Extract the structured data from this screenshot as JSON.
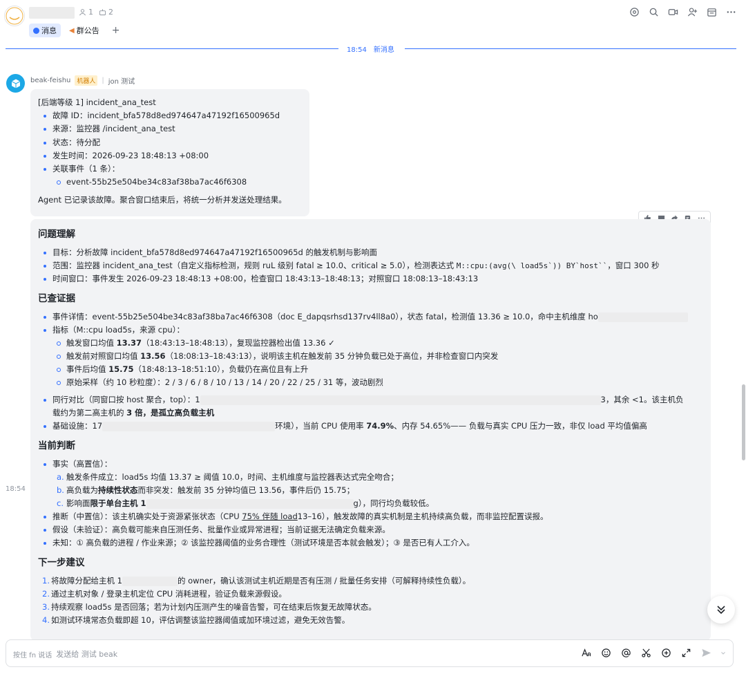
{
  "header": {
    "members_count": "1",
    "bots_count": "2",
    "tabs": [
      {
        "label": "消息"
      },
      {
        "label": "群公告"
      }
    ],
    "add_tab": "+"
  },
  "divider": {
    "time": "18:54",
    "label": "新消息"
  },
  "message": {
    "sender": "beak-feishu",
    "bot_tag": "机器人",
    "separator": "|",
    "reply_to": "jon 测试",
    "side_time": "18:54"
  },
  "card1": {
    "title": "[后端等级 1] incident_ana_test",
    "items": [
      "故障 ID：incident_bfa578d8ed974647a47192f16500965d",
      "来源：监控器 /incident_ana_test",
      "状态：待分配",
      "发生时间：2026-09-23 18:48:13 +08:00",
      "关联事件（1 条）："
    ],
    "sub_item": "event-55b25e504be34c83af38ba7ac46f6308",
    "footer": "Agent 已记录该故障。聚合窗口结束后，将统一分析并发送处理结果。"
  },
  "card2": {
    "sec1": {
      "title": "问题理解",
      "l1": "目标：分析故障 incident_bfa578d8ed974647a47192f16500965d 的触发机制与影响面",
      "l2a": "范围：监控器 incident_ana_test（自定义指标检测，规则 ruL 级别 fatal ≥ 10.0、critical ≥ 5.0），检测表达式 ",
      "l2code": "M::cpu:(avg(\\ load5s`)) BY`host``",
      "l2b": "，窗口 300 秒",
      "l3": "时间窗口：事件发生 2026-09-23 18:48:13 +08:00，检查窗口 18:43:13–18:48:13；对照窗口 18:08:13–18:43:13"
    },
    "sec2": {
      "title": "已查证据",
      "l1": "事件详情：event-55b25e504be34c83af38ba7ac46f6308（doc E_dapqsrhsd137rv4ll8a0），状态 fatal，检测值 13.36 ≥ 10.0，命中主机维度 ho",
      "l2": "指标（M::cpu load5s，来源 cpu）：",
      "s1a": "触发窗口均值 ",
      "s1b": "13.37",
      "s1c": "（18:43:13–18:48:13），复现监控器检出值 13.36 ✓",
      "s2a": "触发前对照窗口均值 ",
      "s2b": "13.56",
      "s2c": "（18:08:13–18:43:13），说明该主机在触发前 35 分钟负载已处于高位，并非检查窗口内突发",
      "s3a": "事件后均值 ",
      "s3b": "15.75",
      "s3c": "（18:48:13–18:51:10），负载仍在高位且有上升",
      "s4": "原始采样（约 10 秒粒度）：2 / 3 / 6 / 8 / 10 / 13 / 14 / 20 / 22 / 25 / 31 等，波动剧烈",
      "l3a": "同行对比（同窗口按 host 聚合，top）：1",
      "l3b": "3，其余 <1。该主机负",
      "l3c": "载约为第二高主机的 ",
      "l3d": "3 倍",
      "l3e": "，是孤立高负载主机",
      "l4a": "基础设施：17",
      "l4b": "环境），当前 CPU 使用率 ",
      "l4c": "74.9%",
      "l4d": "、内存 54.65%—— 负载与真实 CPU 压力一致，非仅 load 平均值偏高"
    },
    "sec3": {
      "title": "当前判断",
      "l1": "事实（高置信）：",
      "a_mk": "a.",
      "a": "触发条件成立：load5s 均值 13.37 ≥ 阈值 10.0，时间、主机维度与监控器表达式完全吻合；",
      "b_mk": "b.",
      "b1": "高负载为",
      "b2": "持续性状态",
      "b3": "而非突发：触发前 35 分钟均值已 13.56，事件后仍 15.75；",
      "c_mk": "c.",
      "c1": "影响面",
      "c2": "限于单台主机",
      "c3": " 1",
      "c4": "g），同行均负载较低。",
      "l2a": "推断（中置信）：该主机确实处于资源紧张状态（CPU ",
      "l2b": "75% 伴随 load",
      "l2c": "13–16），触发故障的真实机制是主机持续高负载，而非监控配置误报。",
      "l3": "假设（未验证）：高负载可能来自压测任务、批量作业或异常进程；当前证据无法确定负载来源。",
      "l4": "未知：① 高负载的进程 / 作业来源；② 该监控器阈值的业务合理性（测试环境是否本就会触发）；③ 是否已有人工介入。"
    },
    "sec4": {
      "title": "下一步建议",
      "items": [
        {
          "mk": "1.",
          "a": "将故障分配给主机 1",
          "b": "的 owner，确认该测试主机近期是否有压测 / 批量任务安排（可解释持续性负载）。"
        },
        {
          "mk": "2.",
          "a": "通过主机对象 / 登录主机定位 CPU 消耗进程，验证负载来源假设。",
          "b": ""
        },
        {
          "mk": "3.",
          "a": "持续观察 load5s 是否回落；若为计划内压测产生的噪音告警，可在结束后恢复无故障状态。",
          "b": ""
        },
        {
          "mk": "4.",
          "a": "如测试环境常态负载即超 10，评估调整该监控器阈值或加环境过滤，避免无效告警。",
          "b": ""
        }
      ]
    }
  },
  "input": {
    "hint": "按住 fn 说话",
    "placeholder": "发送给 测试 beak"
  },
  "icons": {
    "header": [
      "group-avatar-icon",
      "search-icon",
      "video-icon",
      "add-member-icon",
      "calendar-icon",
      "more-icon"
    ],
    "accent": "#3370ff",
    "bot_color": "#1ca8e6"
  }
}
